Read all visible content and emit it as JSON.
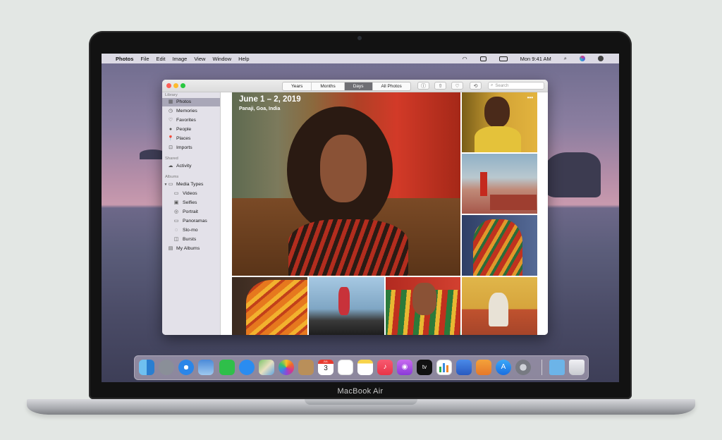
{
  "device": {
    "brand_label": "MacBook Air"
  },
  "menubar": {
    "apple": "",
    "app_name": "Photos",
    "menus": [
      "File",
      "Edit",
      "Image",
      "View",
      "Window",
      "Help"
    ],
    "clock": "Mon 9:41 AM"
  },
  "window": {
    "segments": [
      "Years",
      "Months",
      "Days",
      "All Photos"
    ],
    "active_segment": "Days",
    "search_placeholder": "Search"
  },
  "sidebar": {
    "library_header": "Library",
    "library": [
      "Photos",
      "Memories",
      "Favorites",
      "People",
      "Places",
      "Imports"
    ],
    "shared_header": "Shared",
    "shared": [
      "Activity"
    ],
    "albums_header": "Albums",
    "media_types": "Media Types",
    "media_items": [
      "Videos",
      "Selfies",
      "Portrait",
      "Panoramas",
      "Slo-mo",
      "Bursts"
    ],
    "my_albums": "My Albums",
    "selected": "Photos"
  },
  "hero": {
    "title": "June 1 – 2, 2019",
    "location": "Panaji, Goa, India"
  },
  "more_glyph": "•••",
  "dock_icons": [
    "finder-icon",
    "launchpad-icon",
    "safari-icon",
    "photo-preview-icon",
    "facetime-icon",
    "messages-icon",
    "maps-icon",
    "photos-icon",
    "contacts-icon",
    "calendar-icon",
    "reminders-icon",
    "notes-icon",
    "music-icon",
    "podcasts-icon",
    "tv-icon",
    "numbers-icon",
    "keynote-icon",
    "pages-icon",
    "app-store-icon",
    "system-preferences-icon",
    "downloads-folder-icon",
    "trash-icon"
  ],
  "calendar_badge": {
    "month": "JUL",
    "day": "3"
  },
  "tv_label": "tv"
}
